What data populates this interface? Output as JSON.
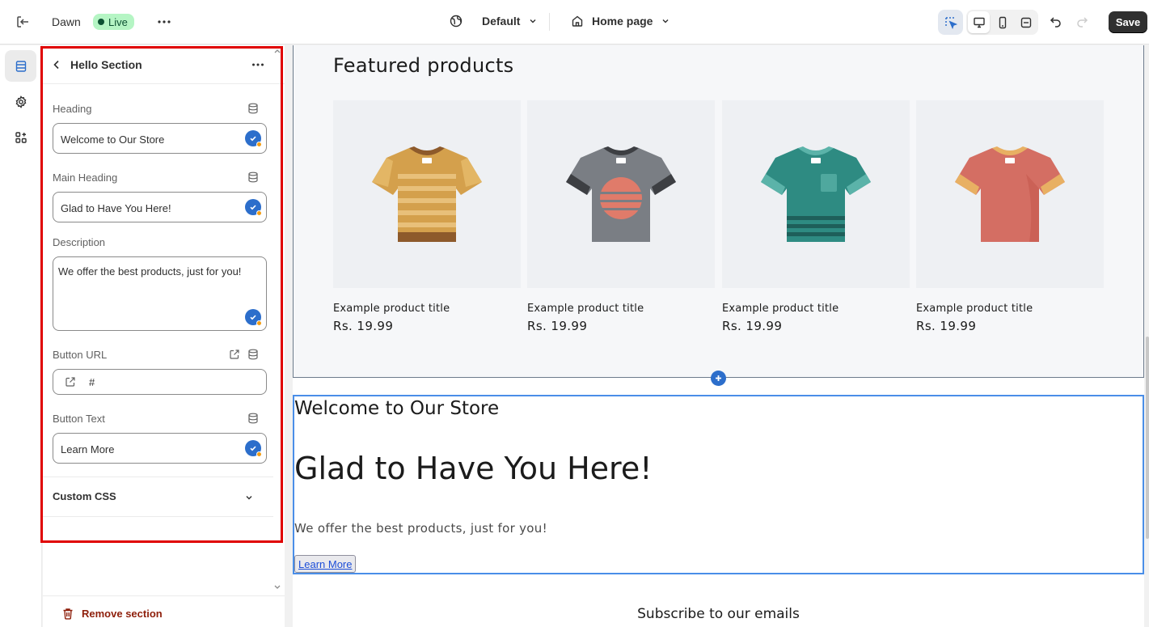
{
  "topbar": {
    "theme_name": "Dawn",
    "live_label": "Live",
    "template_label": "Default",
    "page_label": "Home page",
    "save_label": "Save"
  },
  "sidebar": {
    "section_title": "Hello Section",
    "fields": {
      "heading_label": "Heading",
      "heading_value": "Welcome to Our Store",
      "main_heading_label": "Main Heading",
      "main_heading_value": "Glad to Have You Here!",
      "description_label": "Description",
      "description_value": "We offer the best products, just for you!",
      "button_url_label": "Button URL",
      "button_url_value": "#",
      "button_text_label": "Button Text",
      "button_text_value": "Learn More"
    },
    "custom_css_label": "Custom CSS",
    "remove_label": "Remove section"
  },
  "preview": {
    "featured_title": "Featured products",
    "products": [
      {
        "title": "Example product title",
        "price": "Rs. 19.99",
        "color": "#d4a04c"
      },
      {
        "title": "Example product title",
        "price": "Rs. 19.99",
        "color": "#7a7e84"
      },
      {
        "title": "Example product title",
        "price": "Rs. 19.99",
        "color": "#2e8b82"
      },
      {
        "title": "Example product title",
        "price": "Rs. 19.99",
        "color": "#d46e63"
      }
    ],
    "hello": {
      "heading": "Welcome to Our Store",
      "main_heading": "Glad to Have You Here!",
      "description": "We offer the best products, just for you!",
      "button_text": "Learn More"
    },
    "subscribe_title": "Subscribe to our emails"
  },
  "colors": {
    "accent": "#2c6ecb",
    "live_bg": "#b5f5c4",
    "highlight_border": "#e00000",
    "remove_text": "#8e1f0b"
  }
}
